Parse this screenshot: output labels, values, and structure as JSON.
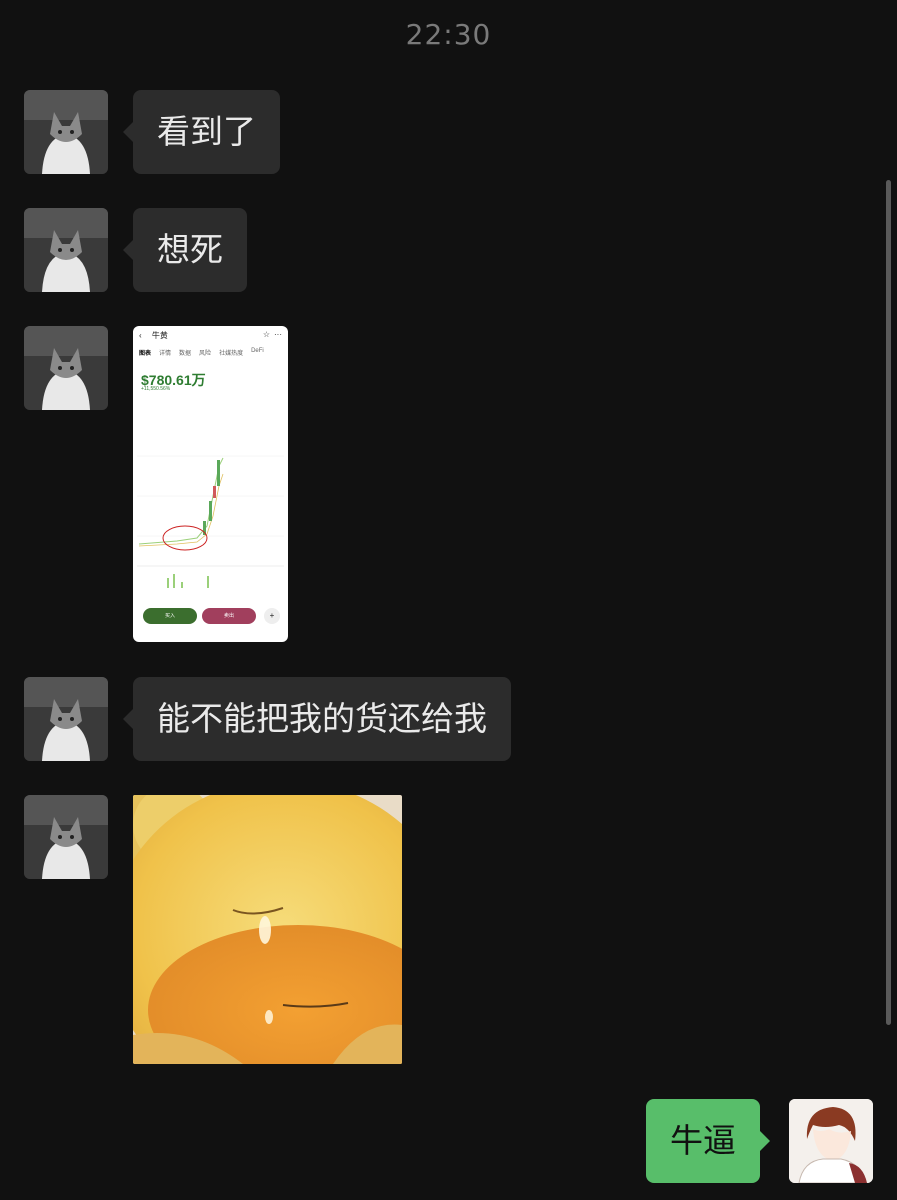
{
  "timestamp": "22:30",
  "messages": [
    {
      "type": "text",
      "side": "in",
      "text": "看到了"
    },
    {
      "type": "text",
      "side": "in",
      "text": "想死"
    },
    {
      "type": "image",
      "side": "in",
      "screenshot": {
        "title": "牛黄",
        "tabs": [
          "图表",
          "详情",
          "数据",
          "风险",
          "社媒热度",
          "DeFi"
        ],
        "price": "$780.61万",
        "change": "+11,550.56%",
        "buy_label": "买入",
        "sell_label": "卖出"
      }
    },
    {
      "type": "text",
      "side": "in",
      "text": "能不能把我的货还给我"
    },
    {
      "type": "image",
      "side": "in",
      "description": "sticker"
    },
    {
      "type": "text",
      "side": "out",
      "text": "牛逼"
    }
  ],
  "colors": {
    "background": "#111111",
    "incoming_bubble": "#2c2c2c",
    "outgoing_bubble": "#58be6a",
    "timestamp": "#7a7a7a"
  }
}
